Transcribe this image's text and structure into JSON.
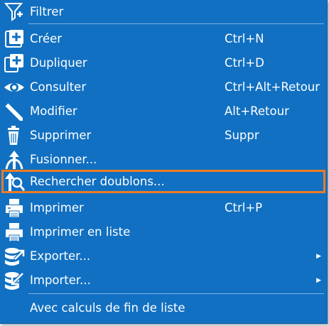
{
  "menu": {
    "items": [
      {
        "label": "Filtrer",
        "shortcut": "",
        "icon": "filter-plus-icon"
      },
      {
        "label": "Créer",
        "shortcut": "Ctrl+N",
        "icon": "create-plus-icon"
      },
      {
        "label": "Dupliquer",
        "shortcut": "Ctrl+D",
        "icon": "duplicate-icon"
      },
      {
        "label": "Consulter",
        "shortcut": "Ctrl+Alt+Retour",
        "icon": "eye-icon"
      },
      {
        "label": "Modifier",
        "shortcut": "Alt+Retour",
        "icon": "pencil-icon"
      },
      {
        "label": "Supprimer",
        "shortcut": "Suppr",
        "icon": "trash-icon"
      },
      {
        "label": "Fusionner...",
        "shortcut": "",
        "icon": "merge-icon"
      },
      {
        "label": "Rechercher doublons...",
        "shortcut": "",
        "icon": "find-duplicates-icon"
      },
      {
        "label": "Imprimer",
        "shortcut": "Ctrl+P",
        "icon": "printer-icon"
      },
      {
        "label": "Imprimer en liste",
        "shortcut": "",
        "icon": "print-list-icon"
      },
      {
        "label": "Exporter...",
        "shortcut": "",
        "icon": "export-icon",
        "submenu": true
      },
      {
        "label": "Importer...",
        "shortcut": "",
        "icon": "import-icon",
        "submenu": true
      },
      {
        "label": "Avec calculs de fin de liste",
        "shortcut": "",
        "icon": ""
      }
    ]
  },
  "colors": {
    "menu_background": "#1170c2",
    "highlight_border": "#ee7b22",
    "text": "#ffffff"
  }
}
